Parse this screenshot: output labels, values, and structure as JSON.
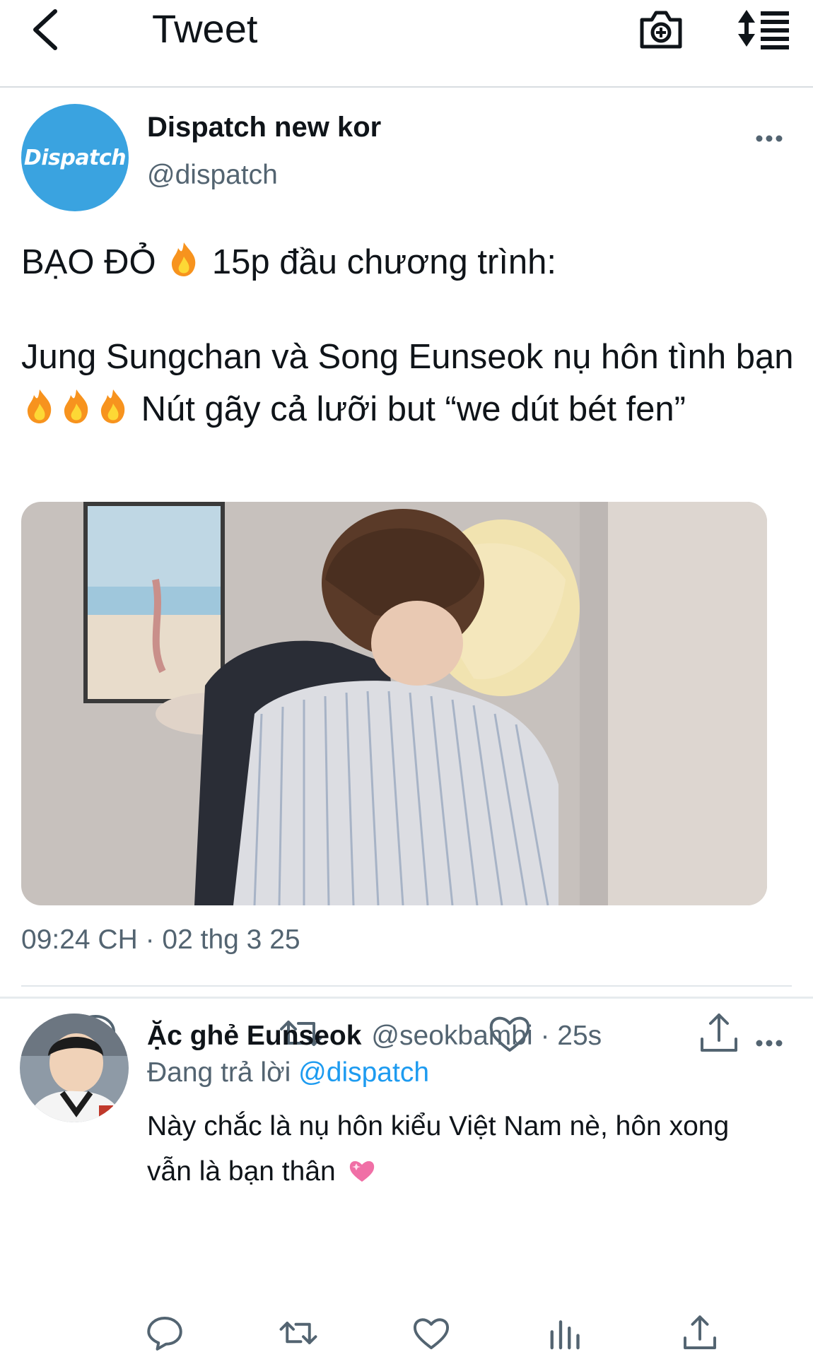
{
  "header": {
    "title": "Tweet"
  },
  "tweet": {
    "author_name": "Dispatch new kor",
    "author_handle": "@dispatch",
    "avatar_text": "Dispatch",
    "text_line1_a": "BẠO ĐỎ",
    "text_line1_b": "15p đầu chương trình:",
    "text_line2_a": "Jung Sungchan và Song Eunseok nụ hôn tình bạn",
    "text_line2_b": "Nút gãy cả lưỡi but “we dút bét fen”",
    "timestamp": "09:24 CH · 02 thg 3 25"
  },
  "reply": {
    "author_name": "Ặc ghẻ Eunseok",
    "author_handle": "@seokbambi",
    "separator": " · ",
    "time": "25s",
    "replying_prefix": "Đang trả lời ",
    "replying_to": "@dispatch",
    "text": "Này chắc là nụ hôn kiểu Việt Nam nè, hôn xong vẫn là bạn thân"
  },
  "colors": {
    "accent": "#1d9bf0",
    "secondary_text": "#536471",
    "avatar_bg": "#3aa3e0",
    "icon": "#536471"
  }
}
